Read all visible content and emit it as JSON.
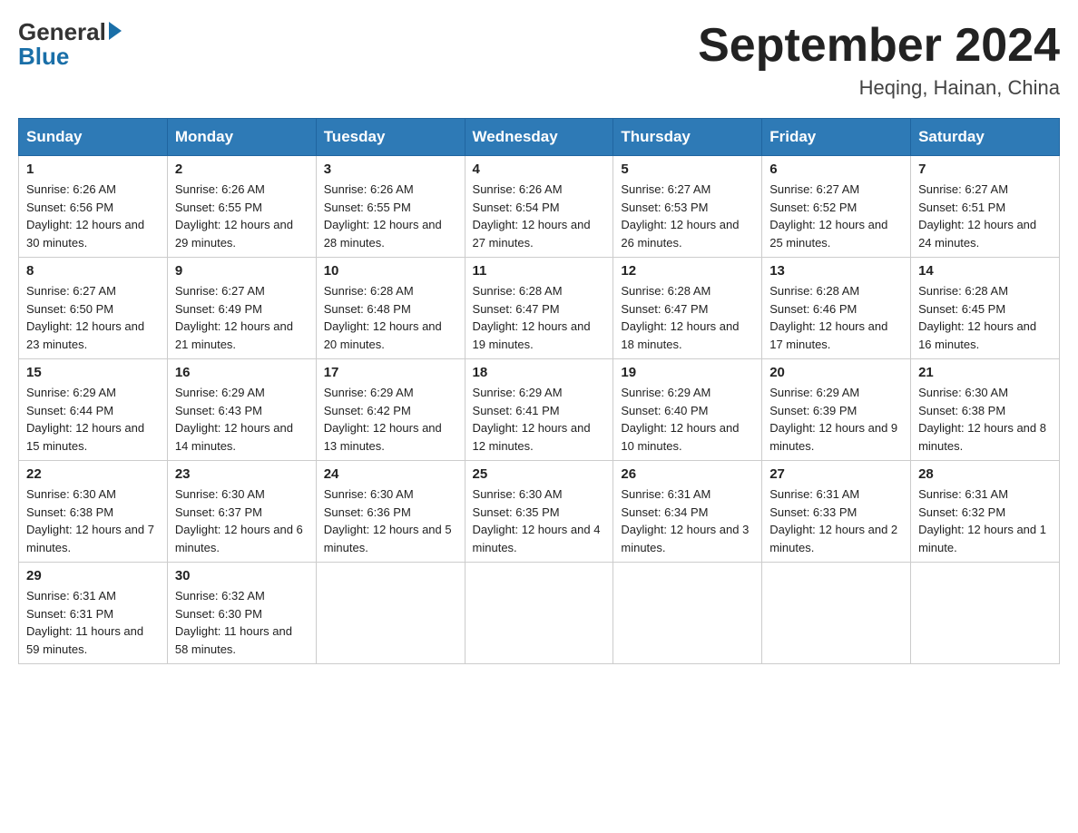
{
  "header": {
    "logo_general": "General",
    "logo_blue": "Blue",
    "title": "September 2024",
    "location": "Heqing, Hainan, China"
  },
  "days_of_week": [
    "Sunday",
    "Monday",
    "Tuesday",
    "Wednesday",
    "Thursday",
    "Friday",
    "Saturday"
  ],
  "weeks": [
    [
      {
        "day": "1",
        "sunrise": "6:26 AM",
        "sunset": "6:56 PM",
        "daylight": "12 hours and 30 minutes."
      },
      {
        "day": "2",
        "sunrise": "6:26 AM",
        "sunset": "6:55 PM",
        "daylight": "12 hours and 29 minutes."
      },
      {
        "day": "3",
        "sunrise": "6:26 AM",
        "sunset": "6:55 PM",
        "daylight": "12 hours and 28 minutes."
      },
      {
        "day": "4",
        "sunrise": "6:26 AM",
        "sunset": "6:54 PM",
        "daylight": "12 hours and 27 minutes."
      },
      {
        "day": "5",
        "sunrise": "6:27 AM",
        "sunset": "6:53 PM",
        "daylight": "12 hours and 26 minutes."
      },
      {
        "day": "6",
        "sunrise": "6:27 AM",
        "sunset": "6:52 PM",
        "daylight": "12 hours and 25 minutes."
      },
      {
        "day": "7",
        "sunrise": "6:27 AM",
        "sunset": "6:51 PM",
        "daylight": "12 hours and 24 minutes."
      }
    ],
    [
      {
        "day": "8",
        "sunrise": "6:27 AM",
        "sunset": "6:50 PM",
        "daylight": "12 hours and 23 minutes."
      },
      {
        "day": "9",
        "sunrise": "6:27 AM",
        "sunset": "6:49 PM",
        "daylight": "12 hours and 21 minutes."
      },
      {
        "day": "10",
        "sunrise": "6:28 AM",
        "sunset": "6:48 PM",
        "daylight": "12 hours and 20 minutes."
      },
      {
        "day": "11",
        "sunrise": "6:28 AM",
        "sunset": "6:47 PM",
        "daylight": "12 hours and 19 minutes."
      },
      {
        "day": "12",
        "sunrise": "6:28 AM",
        "sunset": "6:47 PM",
        "daylight": "12 hours and 18 minutes."
      },
      {
        "day": "13",
        "sunrise": "6:28 AM",
        "sunset": "6:46 PM",
        "daylight": "12 hours and 17 minutes."
      },
      {
        "day": "14",
        "sunrise": "6:28 AM",
        "sunset": "6:45 PM",
        "daylight": "12 hours and 16 minutes."
      }
    ],
    [
      {
        "day": "15",
        "sunrise": "6:29 AM",
        "sunset": "6:44 PM",
        "daylight": "12 hours and 15 minutes."
      },
      {
        "day": "16",
        "sunrise": "6:29 AM",
        "sunset": "6:43 PM",
        "daylight": "12 hours and 14 minutes."
      },
      {
        "day": "17",
        "sunrise": "6:29 AM",
        "sunset": "6:42 PM",
        "daylight": "12 hours and 13 minutes."
      },
      {
        "day": "18",
        "sunrise": "6:29 AM",
        "sunset": "6:41 PM",
        "daylight": "12 hours and 12 minutes."
      },
      {
        "day": "19",
        "sunrise": "6:29 AM",
        "sunset": "6:40 PM",
        "daylight": "12 hours and 10 minutes."
      },
      {
        "day": "20",
        "sunrise": "6:29 AM",
        "sunset": "6:39 PM",
        "daylight": "12 hours and 9 minutes."
      },
      {
        "day": "21",
        "sunrise": "6:30 AM",
        "sunset": "6:38 PM",
        "daylight": "12 hours and 8 minutes."
      }
    ],
    [
      {
        "day": "22",
        "sunrise": "6:30 AM",
        "sunset": "6:38 PM",
        "daylight": "12 hours and 7 minutes."
      },
      {
        "day": "23",
        "sunrise": "6:30 AM",
        "sunset": "6:37 PM",
        "daylight": "12 hours and 6 minutes."
      },
      {
        "day": "24",
        "sunrise": "6:30 AM",
        "sunset": "6:36 PM",
        "daylight": "12 hours and 5 minutes."
      },
      {
        "day": "25",
        "sunrise": "6:30 AM",
        "sunset": "6:35 PM",
        "daylight": "12 hours and 4 minutes."
      },
      {
        "day": "26",
        "sunrise": "6:31 AM",
        "sunset": "6:34 PM",
        "daylight": "12 hours and 3 minutes."
      },
      {
        "day": "27",
        "sunrise": "6:31 AM",
        "sunset": "6:33 PM",
        "daylight": "12 hours and 2 minutes."
      },
      {
        "day": "28",
        "sunrise": "6:31 AM",
        "sunset": "6:32 PM",
        "daylight": "12 hours and 1 minute."
      }
    ],
    [
      {
        "day": "29",
        "sunrise": "6:31 AM",
        "sunset": "6:31 PM",
        "daylight": "11 hours and 59 minutes."
      },
      {
        "day": "30",
        "sunrise": "6:32 AM",
        "sunset": "6:30 PM",
        "daylight": "11 hours and 58 minutes."
      },
      null,
      null,
      null,
      null,
      null
    ]
  ]
}
